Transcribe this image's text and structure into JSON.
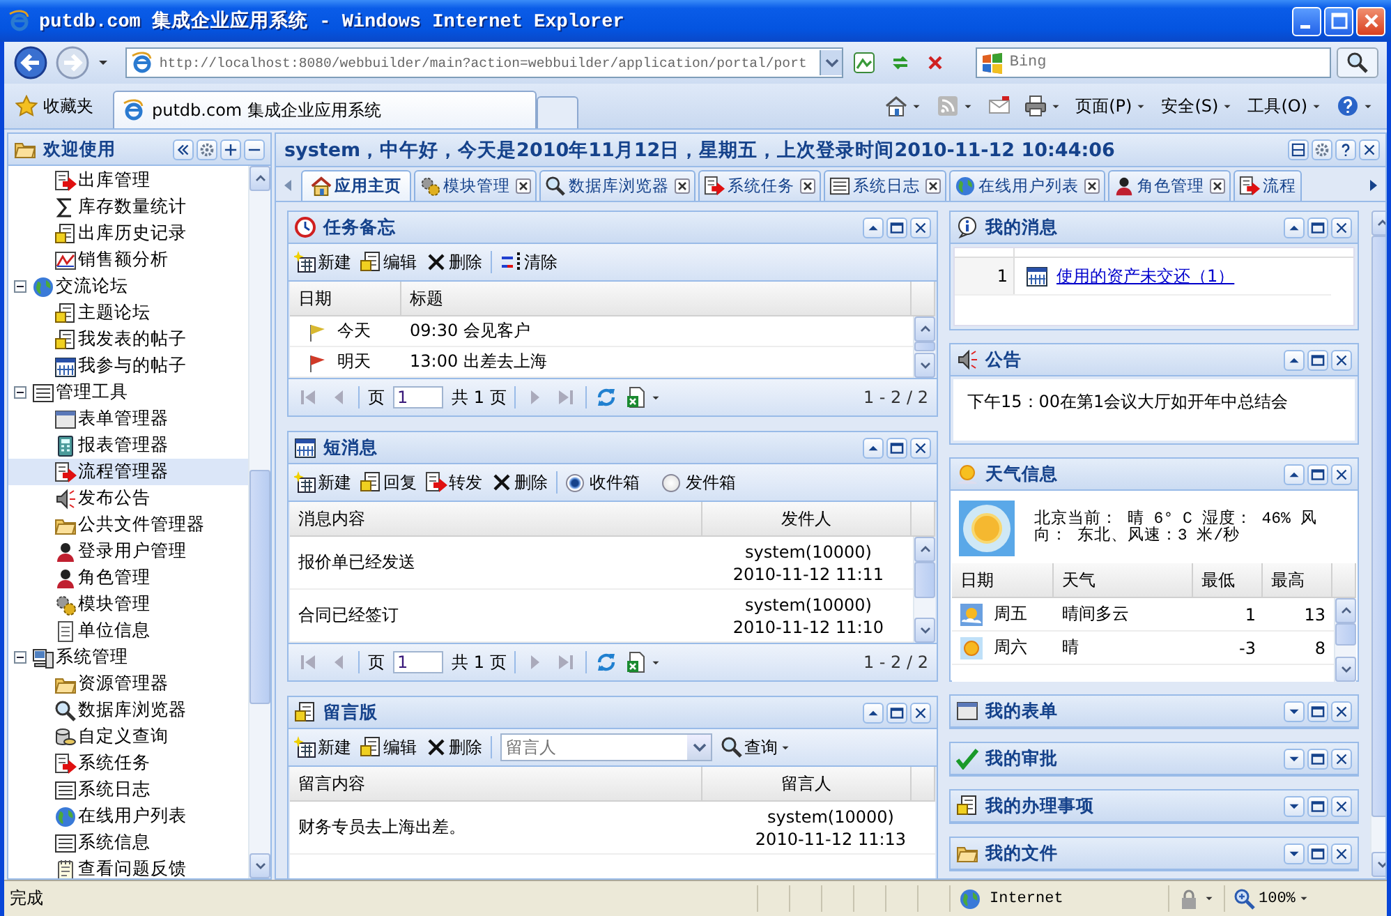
{
  "window": {
    "title": "putdb.com 集成企业应用系统 - Windows Internet Explorer"
  },
  "browser": {
    "address": "http://localhost:8080/webbuilder/main?action=webbuilder/application/portal/port",
    "search_placeholder": "Bing",
    "favorites": "收藏夹",
    "tab": "putdb.com 集成企业应用系统",
    "commands": [
      "页面(P)",
      "安全(S)",
      "工具(O)"
    ]
  },
  "sidebar": {
    "title": "欢迎使用",
    "tree": [
      {
        "children": [
          {
            "label": "出库管理",
            "selected": false
          },
          {
            "label": "库存数量统计",
            "selected": false
          },
          {
            "label": "出库历史记录",
            "selected": false
          },
          {
            "label": "销售额分析",
            "selected": false
          }
        ]
      },
      {
        "label": "交流论坛",
        "expanded": true,
        "children": [
          {
            "label": "主题论坛",
            "selected": false
          },
          {
            "label": "我发表的帖子",
            "selected": false
          },
          {
            "label": "我参与的帖子",
            "selected": false
          }
        ]
      },
      {
        "label": "管理工具",
        "expanded": true,
        "children": [
          {
            "label": "表单管理器",
            "selected": false
          },
          {
            "label": "报表管理器",
            "selected": false
          },
          {
            "label": "流程管理器",
            "selected": true
          },
          {
            "label": "发布公告",
            "selected": false
          },
          {
            "label": "公共文件管理器",
            "selected": false
          },
          {
            "label": "登录用户管理",
            "selected": false
          },
          {
            "label": "角色管理",
            "selected": false
          },
          {
            "label": "模块管理",
            "selected": false
          },
          {
            "label": "单位信息",
            "selected": false
          }
        ]
      },
      {
        "label": "系统管理",
        "expanded": true,
        "children": [
          {
            "label": "资源管理器",
            "selected": false
          },
          {
            "label": "数据库浏览器",
            "selected": false
          },
          {
            "label": "自定义查询",
            "selected": false
          },
          {
            "label": "系统任务",
            "selected": false
          },
          {
            "label": "系统日志",
            "selected": false
          },
          {
            "label": "在线用户列表",
            "selected": false
          },
          {
            "label": "系统信息",
            "selected": false
          },
          {
            "label": "查看问题反馈",
            "selected": false
          }
        ]
      }
    ]
  },
  "header": {
    "greeting": "system，中午好，今天是2010年11月12日，星期五，上次登录时间2010-11-12 10:44:06"
  },
  "tabs": [
    {
      "label": "应用主页",
      "selected": true,
      "closable": false
    },
    {
      "label": "模块管理",
      "selected": false,
      "closable": true
    },
    {
      "label": "数据库浏览器",
      "selected": false,
      "closable": true
    },
    {
      "label": "系统任务",
      "selected": false,
      "closable": true
    },
    {
      "label": "系统日志",
      "selected": false,
      "closable": true
    },
    {
      "label": "在线用户列表",
      "selected": false,
      "closable": true
    },
    {
      "label": "角色管理",
      "selected": false,
      "closable": true
    },
    {
      "label": "流程",
      "selected": false,
      "closable": false
    }
  ],
  "left_panels": [
    {
      "kind": "memo",
      "title": "任务备忘",
      "collapsed": false,
      "toolbar": [
        {
          "kind": "button",
          "label": "新建"
        },
        {
          "kind": "button",
          "label": "编辑"
        },
        {
          "kind": "button",
          "label": "删除"
        },
        {
          "kind": "separator"
        },
        {
          "kind": "button",
          "label": "清除"
        }
      ],
      "columns": [
        "日期",
        "标题"
      ],
      "rows": [
        {
          "color": "#d8b830",
          "cells": [
            "今天",
            "09:30 会见客户"
          ]
        },
        {
          "color": "#d03a28",
          "cells": [
            "明天",
            "13:00 出差去上海"
          ]
        }
      ],
      "pager": {
        "page_label": "页",
        "page": "1",
        "total": "共 1 页",
        "summary": "1 - 2 / 2"
      }
    },
    {
      "kind": "sender_grid",
      "title": "短消息",
      "collapsed": false,
      "toolbar": [
        {
          "kind": "button",
          "label": "新建"
        },
        {
          "kind": "button",
          "label": "回复"
        },
        {
          "kind": "button",
          "label": "转发"
        },
        {
          "kind": "button",
          "label": "删除"
        },
        {
          "kind": "separator"
        },
        {
          "kind": "radio",
          "label": "收件箱",
          "selected": true
        },
        {
          "kind": "radio",
          "label": "发件箱",
          "selected": false
        }
      ],
      "columns": [
        "消息内容",
        "发件人"
      ],
      "rows": [
        {
          "cells": [
            "报价单已经发送",
            "system(10000)\n2010-11-12 11:11"
          ]
        },
        {
          "cells": [
            "合同已经签订",
            "system(10000)\n2010-11-12 11:10"
          ]
        }
      ],
      "pager": {
        "page_label": "页",
        "page": "1",
        "total": "共 1 页",
        "summary": "1 - 2 / 2"
      }
    },
    {
      "kind": "sender_grid",
      "title": "留言版",
      "collapsed": false,
      "toolbar": [
        {
          "kind": "button",
          "label": "新建"
        },
        {
          "kind": "button",
          "label": "编辑"
        },
        {
          "kind": "button",
          "label": "删除"
        },
        {
          "kind": "separator"
        },
        {
          "kind": "combo",
          "placeholder": "留言人"
        },
        {
          "kind": "menu_button",
          "label": "查询"
        }
      ],
      "columns": [
        "留言内容",
        "留言人"
      ],
      "rows": [
        {
          "cells": [
            "财务专员去上海出差。",
            "system(10000)\n2010-11-12 11:13"
          ]
        }
      ]
    }
  ],
  "right_panels": [
    {
      "kind": "messages",
      "title": "我的消息",
      "collapsed": false,
      "rows": [
        {
          "number": "1",
          "link": "使用的资产未交还（1）"
        }
      ]
    },
    {
      "kind": "text",
      "title": "公告",
      "collapsed": false,
      "text": "下午15：00在第1会议大厅如开年中总结会"
    },
    {
      "kind": "weather",
      "title": "天气信息",
      "collapsed": false,
      "summary": "北京当前： 晴 6° C 湿度： 46% 风向： 东北、风速：3 米/秒",
      "columns": [
        "日期",
        "天气",
        "最低",
        "最高"
      ],
      "rows": [
        {
          "cells": [
            "周五",
            "晴间多云",
            "1",
            "13"
          ]
        },
        {
          "cells": [
            "周六",
            "晴",
            "-3",
            "8"
          ]
        }
      ]
    },
    {
      "kind": "empty",
      "title": "我的表单",
      "collapsed": true
    },
    {
      "kind": "empty",
      "title": "我的审批",
      "collapsed": true
    },
    {
      "kind": "empty",
      "title": "我的办理事项",
      "collapsed": true
    },
    {
      "kind": "empty",
      "title": "我的文件",
      "collapsed": true
    }
  ],
  "status_bar": {
    "status": "完成",
    "zone": "Internet",
    "zoom": "100%"
  }
}
